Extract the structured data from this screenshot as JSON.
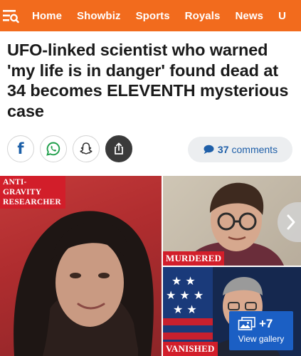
{
  "nav": {
    "items": [
      "Home",
      "Showbiz",
      "Sports",
      "Royals",
      "News",
      "U"
    ]
  },
  "article": {
    "headline": "UFO-linked scientist who warned 'my life is in danger' found dead at 34 becomes ELEVENTH mysterious case"
  },
  "share": {
    "facebook_label": "f",
    "icons": [
      "facebook-icon",
      "whatsapp-icon",
      "snapchat-icon",
      "share-icon"
    ]
  },
  "comments": {
    "count": "37",
    "label": "comments"
  },
  "gallery": {
    "captions": {
      "main": "ANTI-GRAVITY RESEARCHER",
      "top_right": "MURDERED",
      "bottom_right": "VANISHED"
    },
    "more_count": "+7",
    "view_label": "View gallery"
  },
  "colors": {
    "brand_orange": "#f26b1d",
    "comments_blue": "#1f5fa8",
    "caption_red": "#d21e2a",
    "gallery_button_blue": "#1b5fc4"
  }
}
